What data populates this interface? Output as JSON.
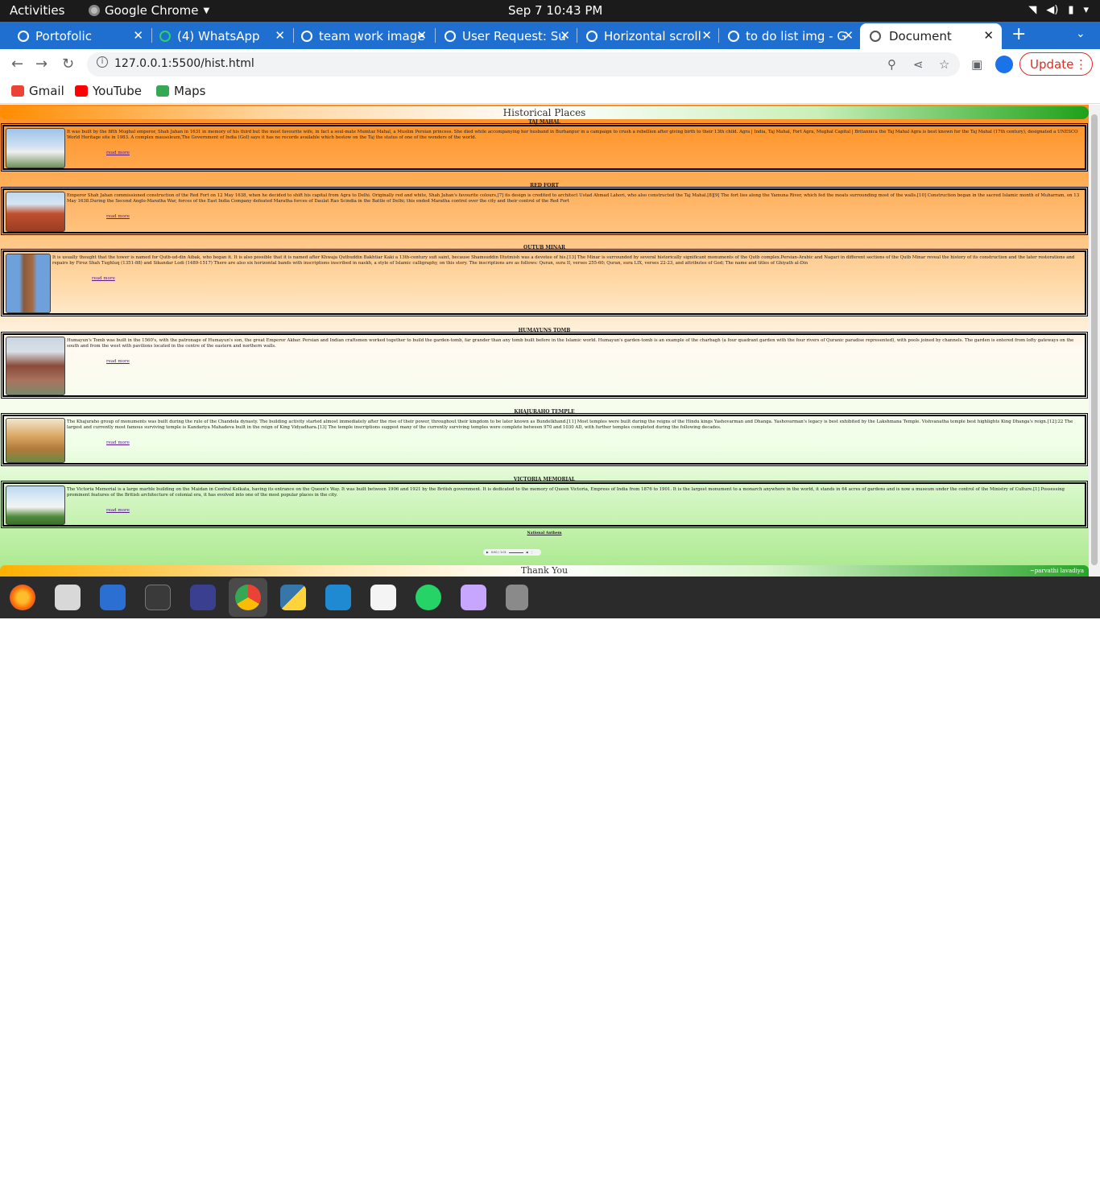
{
  "system": {
    "activities": "Activities",
    "app_name": "Google Chrome",
    "clock": "Sep 7  10:43 PM"
  },
  "tabs": [
    {
      "label": "Portofolic"
    },
    {
      "label": "(4) WhatsApp"
    },
    {
      "label": "team work image"
    },
    {
      "label": "User Request: Su"
    },
    {
      "label": "Horizontal scroll"
    },
    {
      "label": "to do list img - G"
    },
    {
      "label": "Document"
    }
  ],
  "toolbar": {
    "url": "127.0.0.1:5500/hist.html",
    "update_label": "Update"
  },
  "bookmarks": [
    {
      "label": "Gmail",
      "color": "#ea4335"
    },
    {
      "label": "YouTube",
      "color": "#ff0000"
    },
    {
      "label": "Maps",
      "color": "#34a853"
    }
  ],
  "page": {
    "header": "Historical Places",
    "anthem": "National Anthem",
    "player_time": "0:00 / 1:01",
    "footer": "Thank You",
    "credit": "~parvathi lavadiya",
    "sections": [
      {
        "title": "TAJ MAHAL",
        "read_more": "read more",
        "text": "It was built by the fifth Mughal emperor, Shah Jahan in 1631 in memory of his third but the most favourite wife, in fact a soul-mate Mumtaz Mahal, a Muslim Persian princess. She died while accompanying her husband in Burhanpur in a campaign to crush a rebellion after giving birth to their 13th child. Agra | India, Taj Mahal, Fort Agra, Mughal Capital | Britannica the Taj Mahal Agra is best known for the Taj Mahal (17th century), designated a UNESCO World Heritage site in 1983. A complex mausoleum,The Government of India (GoI) says it has no records available which bestow on the Taj the status of one of the wonders of the world."
      },
      {
        "title": "RED FORT",
        "read_more": "read more",
        "text": "Emperor Shah Jahan commissioned construction of the Red Fort on 12 May 1638, when he decided to shift his capital from Agra to Delhi. Originally red and white, Shah Jahan's favourite colours,[7] its design is credited to architect Ustad Ahmad Lahori, who also constructed the Taj Mahal.[8][9] The fort lies along the Yamuna River, which fed the moats surrounding most of the walls.[10] Construction began in the sacred Islamic month of Muharram, on 13 May 1638.During the Second Anglo-Maratha War, forces of the East India Company defeated Maratha forces of Daulat Rao Scindia in the Battle of Delhi; this ended Maratha control over the city and their control of the Red Fort"
      },
      {
        "title": "QUTUB MINAR",
        "read_more": "read more",
        "text": "It is usually thought that the tower is named for Qutb-ud-din Aibak, who began it. It is also possible that it is named after Khwaja Qutbuddin Bakhtiar Kaki a 13th-century sufi saint, because Shamsuddin Iltutmish was a devotee of his.[13] The Minar is surrounded by several historically significant monuments of the Qutb complex.Persian-Arabic and Nagari in different sections of the Qutb Minar reveal the history of its construction and the later restorations and repairs by Firoz Shah Tughluq (1351-88) and Sikandar Lodi (1489-1517) There are also six horizontal bands with inscriptions inscribed in naskh, a style of Islamic calligraphy, on this story. The inscriptions are as follows: Quran, sura II, verses 255-60; Quran, sura LIX, verses 22-23, and attributes of God; The name and titles of Ghiyath al-Din"
      },
      {
        "title": "HUMAYUNS TOMB",
        "read_more": "read more",
        "text": "Humayun's Tomb was built in the 1560's, with the patronage of Humayun's son, the great Emperor Akbar. Persian and Indian craftsmen worked together to build the garden-tomb, far grander than any tomb built before in the Islamic world. Humayun's garden-tomb is an example of the charbagh (a four quadrant garden with the four rivers of Quranic paradise represented), with pools joined by channels. The garden is entered from lofty gateways on the south and from the west with pavilions located in the centre of the eastern and northern walls."
      },
      {
        "title": "KHAJURAHO TEMPLE",
        "read_more": "read more",
        "text": "The Khajuraho group of monuments was built during the rule of the Chandela dynasty. The building activity started almost immediately after the rise of their power, throughout their kingdom to be later known as Bundelkhand.[11] Most temples were built during the reigns of the Hindu kings Yashovarman and Dhanga. Yashovarman's legacy is best exhibited by the Lakshmana Temple. Vishvanatha temple best highlights King Dhanga's reign.[12]:22 The largest and currently most famous surviving temple is Kandariya Mahadeva built in the reign of King Vidyadhara.[13] The temple inscriptions suggest many of the currently surviving temples were complete between 970 and 1030 AD, with further temples completed during the following decades."
      },
      {
        "title": "VICTORIA MEMORIAL",
        "read_more": "read more",
        "text": "The Victoria Memorial is a large marble building on the Maidan in Central Kolkata, having its entrance on the Queen's Way. It was built between 1906 and 1921 by the British government. It is dedicated to the memory of Queen Victoria, Empress of India from 1876 to 1901. It is the largest monument to a monarch anywhere in the world, it stands in 64 acres of gardens and is now a museum under the control of the Ministry of Culture.[1] Possessing prominent features of the British architecture of colonial era, it has evolved into one of the most popular places in the city."
      }
    ]
  },
  "dock": [
    "firefox-icon",
    "files-icon",
    "writer-icon",
    "terminal-icon",
    "texmaker-icon",
    "chrome-icon",
    "python-icon",
    "vscode-icon",
    "text-editor-icon",
    "whatsapp-icon",
    "software-icon",
    "archive-icon"
  ]
}
